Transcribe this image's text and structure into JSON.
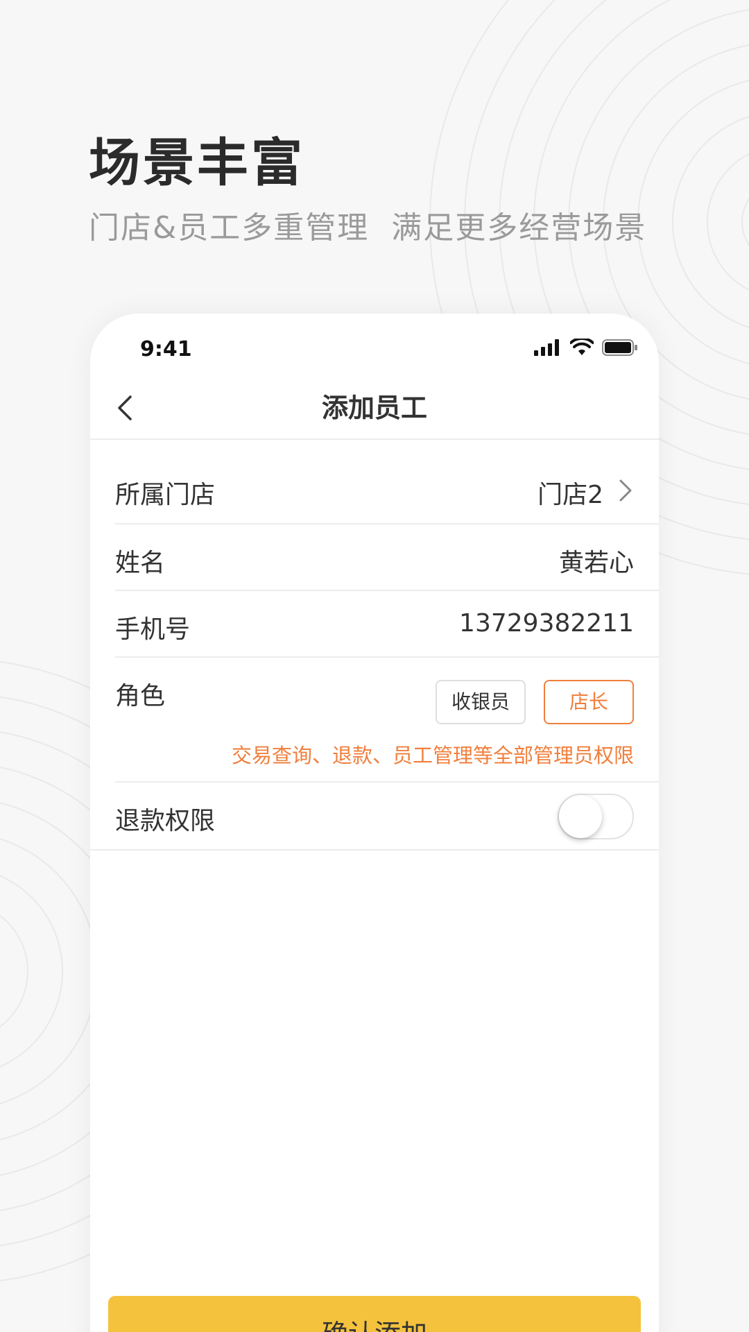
{
  "hero": {
    "title": "场景丰富",
    "subtitle": "门店&员工多重管理  满足更多经营场景"
  },
  "status_bar": {
    "time": "9:41",
    "icons": [
      "signal-icon",
      "wifi-icon",
      "battery-icon"
    ]
  },
  "nav": {
    "back_icon": "chevron-left-icon",
    "title": "添加员工"
  },
  "form": {
    "store": {
      "label": "所属门店",
      "value": "门店2"
    },
    "name": {
      "label": "姓名",
      "value": "黄若心"
    },
    "phone": {
      "label": "手机号",
      "value": "13729382211"
    },
    "role": {
      "label": "角色",
      "options": [
        "收银员",
        "店长"
      ],
      "selected": "店长",
      "description": "交易查询、退款、员工管理等全部管理员权限"
    },
    "refund": {
      "label": "退款权限",
      "enabled": false
    }
  },
  "confirm_label": "确认添加",
  "colors": {
    "accent_orange": "#f07f3c",
    "button_yellow": "#f4c23c",
    "text_dark": "#333333",
    "text_gray": "#9a9a9a"
  }
}
